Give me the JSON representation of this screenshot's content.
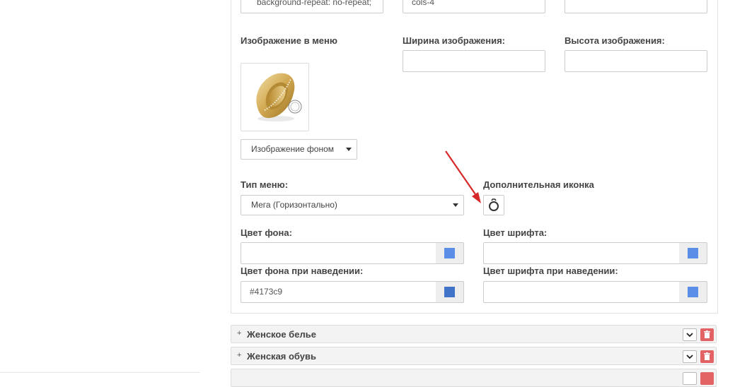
{
  "top_inputs": {
    "background_value": "background-repeat: no-repeat;",
    "cols_value": "cols-4",
    "third_value": ""
  },
  "menu_image": {
    "label": "Изображение в меню",
    "image_alt": "Кольцо",
    "mode_select": "Изображение фоном"
  },
  "image_width": {
    "label": "Ширина изображения:",
    "value": ""
  },
  "image_height": {
    "label": "Высота изображения:",
    "value": ""
  },
  "menu_type": {
    "label": "Тип меню:",
    "value": "Мега (Горизонтально)"
  },
  "extra_icon": {
    "label": "Дополнительная иконка",
    "icon": "ring-icon"
  },
  "bg_color": {
    "label": "Цвет фона:",
    "value": "",
    "swatch": "#5b8ee6"
  },
  "font_color": {
    "label": "Цвет шрифта:",
    "value": "",
    "swatch": "#5b8ee6"
  },
  "bg_hover_color": {
    "label": "Цвет фона при наведении:",
    "value": "#4173c9",
    "swatch": "#4173c9"
  },
  "font_hover_color": {
    "label": "Цвет шрифта при наведении:",
    "value": "",
    "swatch": "#5b8ee6"
  },
  "accordion": [
    {
      "title": "Женское белье",
      "icon_expand": "plus-icon",
      "icon_toggle": "chevron-down-icon",
      "icon_delete": "trash-icon"
    },
    {
      "title": "Женская обувь",
      "icon_expand": "plus-icon",
      "icon_toggle": "chevron-down-icon",
      "icon_delete": "trash-icon"
    }
  ],
  "colors": {
    "annotation_arrow": "#d62828",
    "delete_button": "#e36264"
  }
}
